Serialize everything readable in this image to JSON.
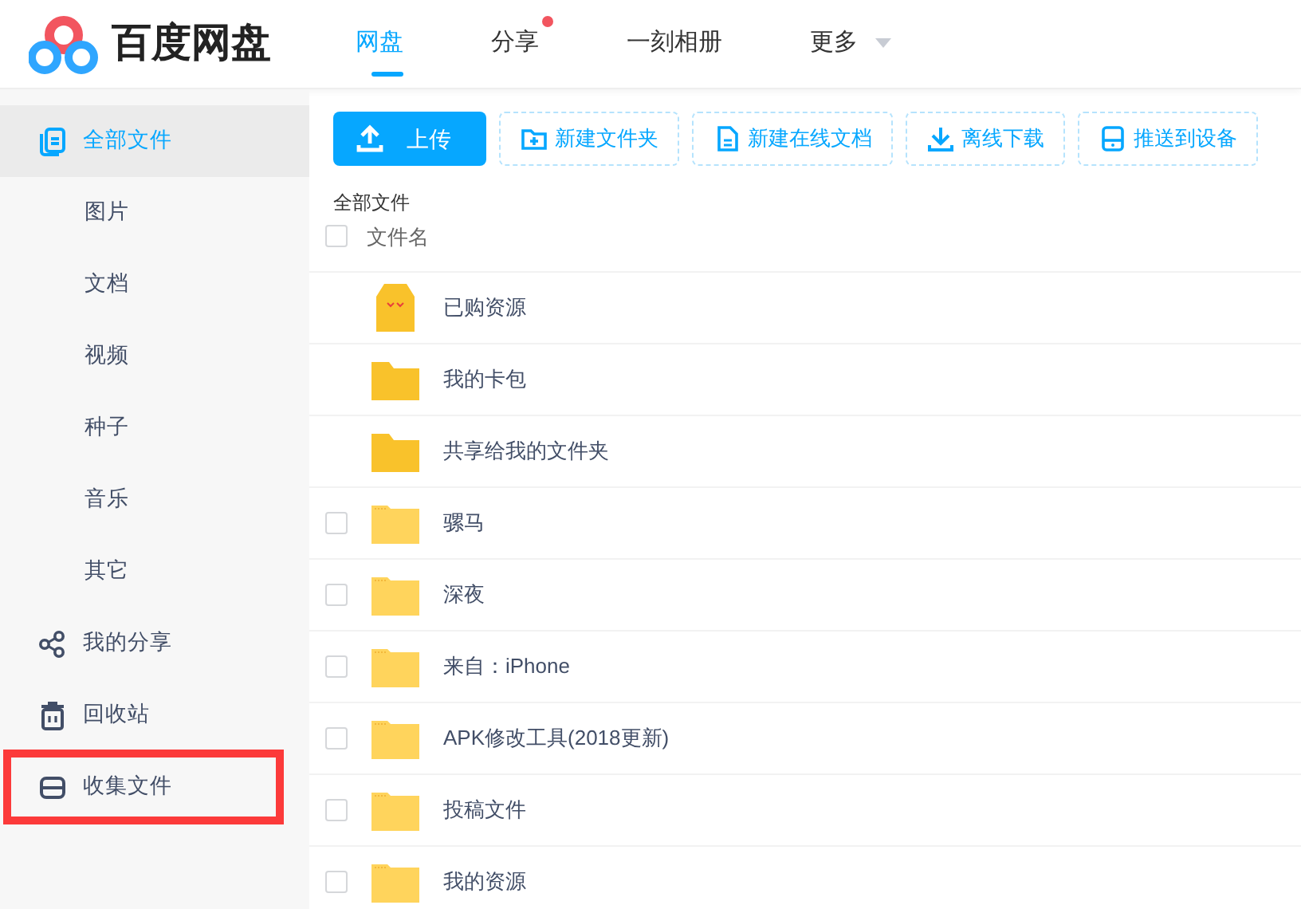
{
  "logo": {
    "text": "百度网盘"
  },
  "nav": [
    {
      "label": "网盘",
      "selected": true,
      "notification": false,
      "dropdown": false
    },
    {
      "label": "分享",
      "selected": false,
      "notification": true,
      "dropdown": false
    },
    {
      "label": "一刻相册",
      "selected": false,
      "notification": false,
      "dropdown": false
    },
    {
      "label": "更多",
      "selected": false,
      "notification": false,
      "dropdown": true
    }
  ],
  "sidebar": {
    "items": [
      {
        "label": "全部文件",
        "selected": true,
        "annotated": false,
        "children": [
          {
            "label": "图片",
            "selected": false
          },
          {
            "label": "文档",
            "selected": false
          },
          {
            "label": "视频",
            "selected": false
          },
          {
            "label": "种子",
            "selected": false
          },
          {
            "label": "音乐",
            "selected": false
          },
          {
            "label": "其它",
            "selected": false
          }
        ]
      },
      {
        "label": "我的分享",
        "selected": false,
        "annotated": false
      },
      {
        "label": "回收站",
        "selected": false,
        "annotated": false
      },
      {
        "label": "收集文件",
        "selected": false,
        "annotated": true
      }
    ]
  },
  "toolbar": [
    {
      "label": "上传",
      "primary": true
    },
    {
      "label": "新建文件夹",
      "primary": false
    },
    {
      "label": "新建在线文档",
      "primary": false
    },
    {
      "label": "离线下载",
      "primary": false
    },
    {
      "label": "推送到设备",
      "primary": false
    }
  ],
  "breadcrumb": "全部文件",
  "table": {
    "header": {
      "label": "文件名",
      "checked": false
    },
    "rows": [
      {
        "name": "已购资源",
        "kind": "bag"
      },
      {
        "name": "我的卡包",
        "kind": "system-folder"
      },
      {
        "name": "共享给我的文件夹",
        "kind": "system-folder"
      },
      {
        "name": "骡马",
        "kind": "folder",
        "checked": false
      },
      {
        "name": "深夜",
        "kind": "folder",
        "checked": false
      },
      {
        "name": "来自：iPhone",
        "kind": "folder",
        "checked": false
      },
      {
        "name": "APK修改工具(2018更新)",
        "kind": "folder",
        "checked": false
      },
      {
        "name": "投稿文件",
        "kind": "folder",
        "checked": false
      },
      {
        "name": "我的资源",
        "kind": "folder",
        "checked": false
      }
    ]
  }
}
